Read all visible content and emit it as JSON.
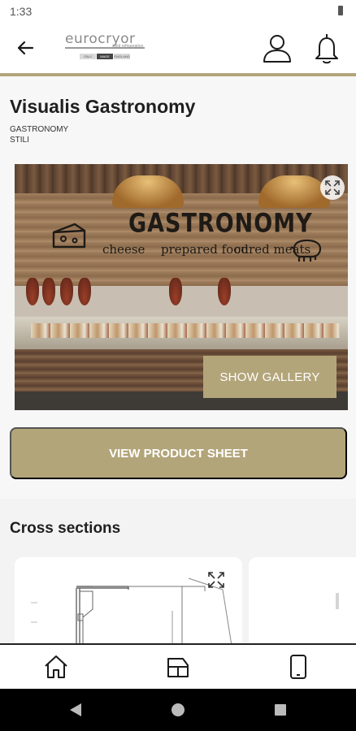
{
  "status_bar": {
    "time": "1:33"
  },
  "header": {
    "logo": {
      "brand": "eurocryor",
      "tagline": "solid refrigeration",
      "strip": [
        "ITALY",
        "MADE",
        "ENGLAND"
      ]
    },
    "icons": [
      "back-arrow-icon",
      "user-icon",
      "bell-icon"
    ]
  },
  "product": {
    "title": "Visualis Gastronomy",
    "category": "GASTRONOMY",
    "line": "STILI",
    "hero": {
      "sign": "GASTRONOMY",
      "sub_labels": [
        "cheese",
        "prepared food",
        "cured meats"
      ]
    },
    "show_gallery_label": "SHOW GALLERY",
    "view_sheet_label": "VIEW PRODUCT SHEET"
  },
  "cross_sections": {
    "title": "Cross sections"
  },
  "bottom_nav": {
    "items": [
      {
        "icon": "home-icon"
      },
      {
        "icon": "showcase-icon"
      },
      {
        "icon": "mobile-icon"
      }
    ]
  },
  "colors": {
    "accent": "#b3a57a",
    "nav_border": "#222222"
  }
}
